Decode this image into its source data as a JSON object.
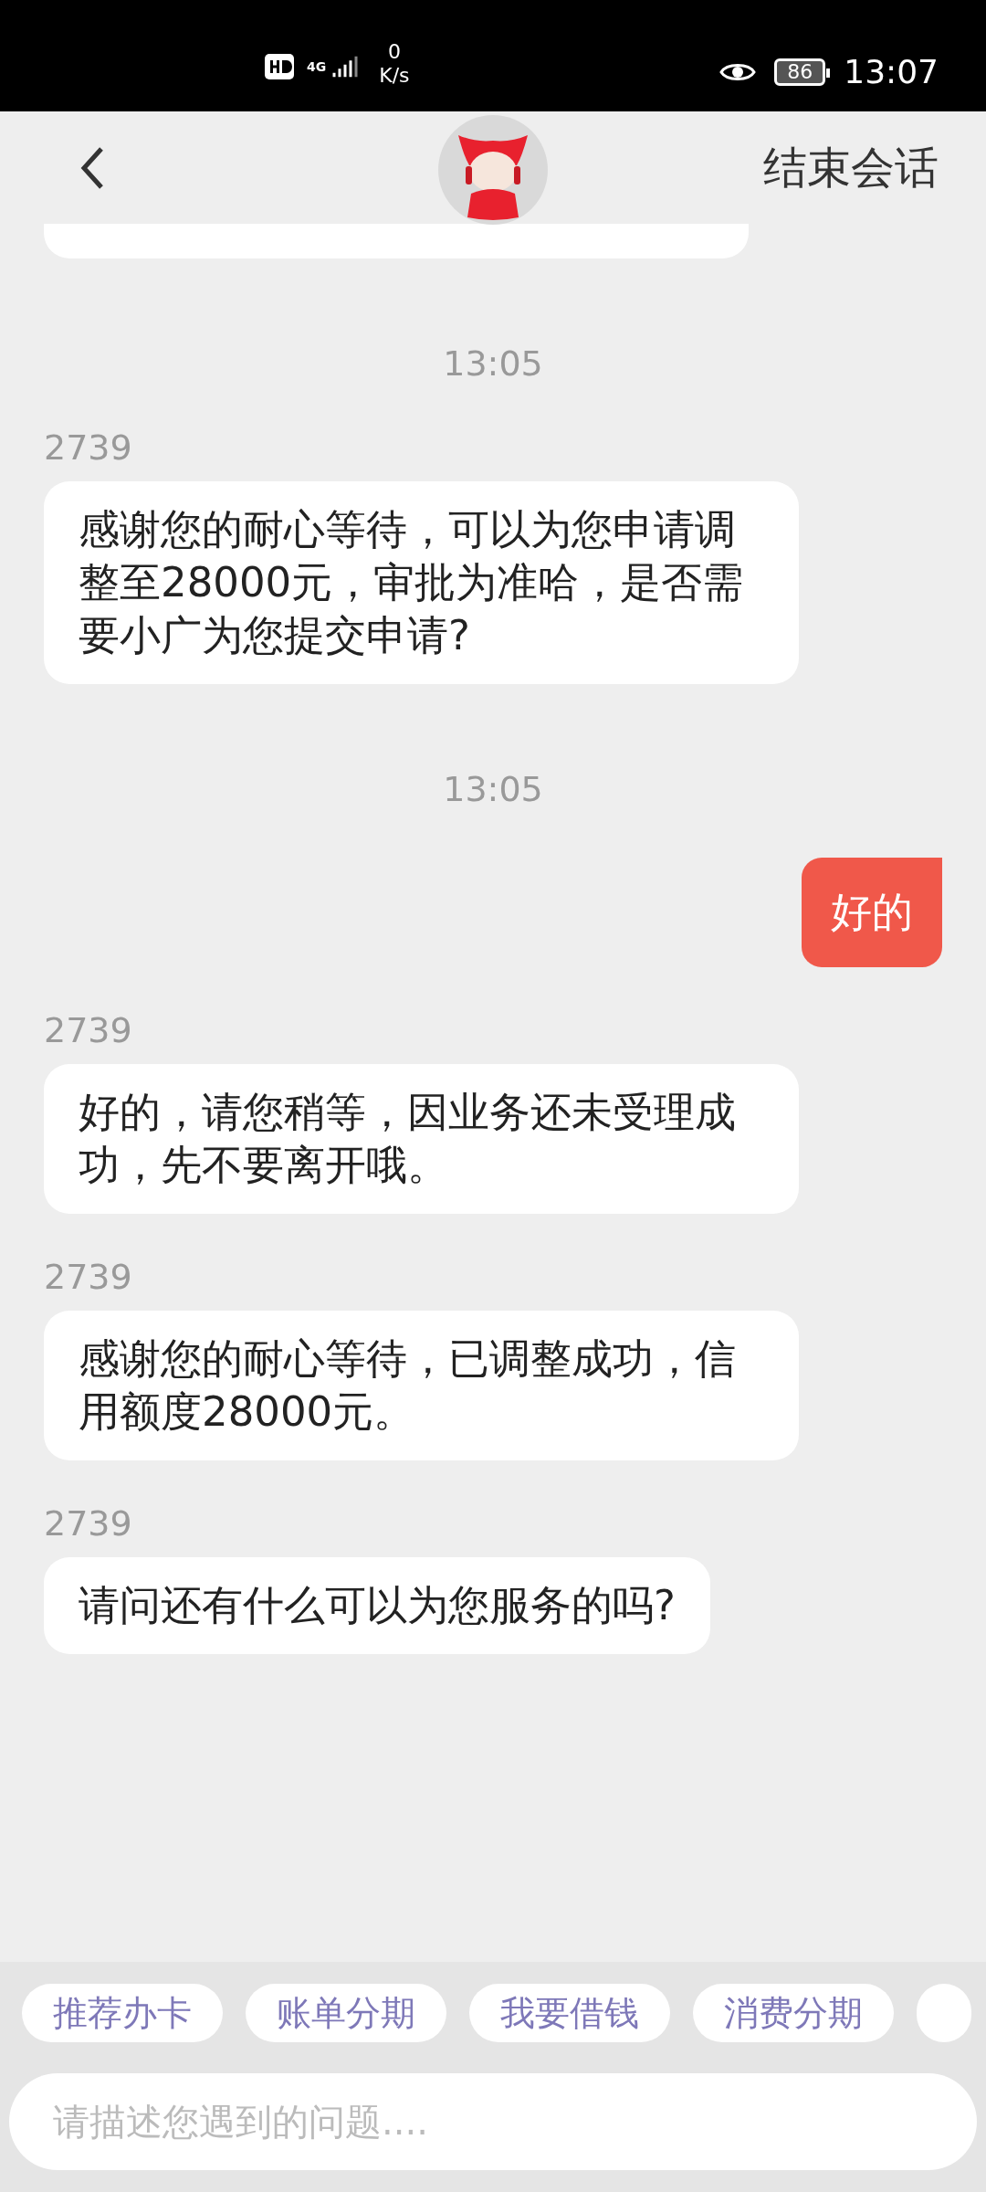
{
  "status_bar": {
    "network": "4G",
    "speed_value": "0",
    "speed_unit": "K/s",
    "battery": "86",
    "time": "13:07"
  },
  "header": {
    "action": "结束会话"
  },
  "messages": [
    {
      "kind": "time",
      "text": "13:05"
    },
    {
      "kind": "agent",
      "sender": "2739",
      "text": "感谢您的耐心等待，可以为您申请调整至28000元，审批为准哈，是否需要小广为您提交申请?"
    },
    {
      "kind": "time",
      "text": "13:05"
    },
    {
      "kind": "user",
      "text": "好的"
    },
    {
      "kind": "agent",
      "sender": "2739",
      "text": "好的，请您稍等，因业务还未受理成功，先不要离开哦。"
    },
    {
      "kind": "agent",
      "sender": "2739",
      "text": "感谢您的耐心等待，已调整成功，信用额度28000元。"
    },
    {
      "kind": "agent",
      "sender": "2739",
      "text": "请问还有什么可以为您服务的吗?"
    }
  ],
  "quick_replies": [
    "推荐办卡",
    "账单分期",
    "我要借钱",
    "消费分期"
  ],
  "input": {
    "placeholder": "请描述您遇到的问题...."
  }
}
